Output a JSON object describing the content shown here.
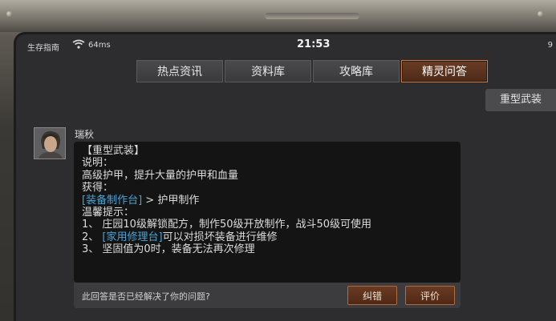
{
  "statusbar": {
    "carrier": "生存指南",
    "ping": "64ms",
    "time": "21:53",
    "right_glyph": "9"
  },
  "tabs": [
    {
      "label": "热点资讯",
      "active": false
    },
    {
      "label": "资料库",
      "active": false
    },
    {
      "label": "攻略库",
      "active": false
    },
    {
      "label": "精灵问答",
      "active": true
    }
  ],
  "question_bubble": "重型武装",
  "answer": {
    "author": "瑞秋",
    "lines": {
      "title": "【重型武装】",
      "desc_label": "说明：",
      "desc": "高级护甲，提升大量的护甲和血量",
      "obtain_label": "获得：",
      "obtain_link": "[装备制作台]",
      "obtain_rest": " > 护甲制作",
      "tips_label": "温馨提示：",
      "tip1": "1、 庄园10级解锁配方，制作50级开放制作，战斗50级可使用",
      "tip2_prefix": "2、 ",
      "tip2_link": "[家用修理台]",
      "tip2_rest": "可以对损坏装备进行维修",
      "tip3": "3、 坚固值为0时，装备无法再次修理"
    }
  },
  "feedback": {
    "question": "此回答是否已经解决了你的问题?",
    "correct_btn": "纠错",
    "rate_btn": "评价"
  }
}
